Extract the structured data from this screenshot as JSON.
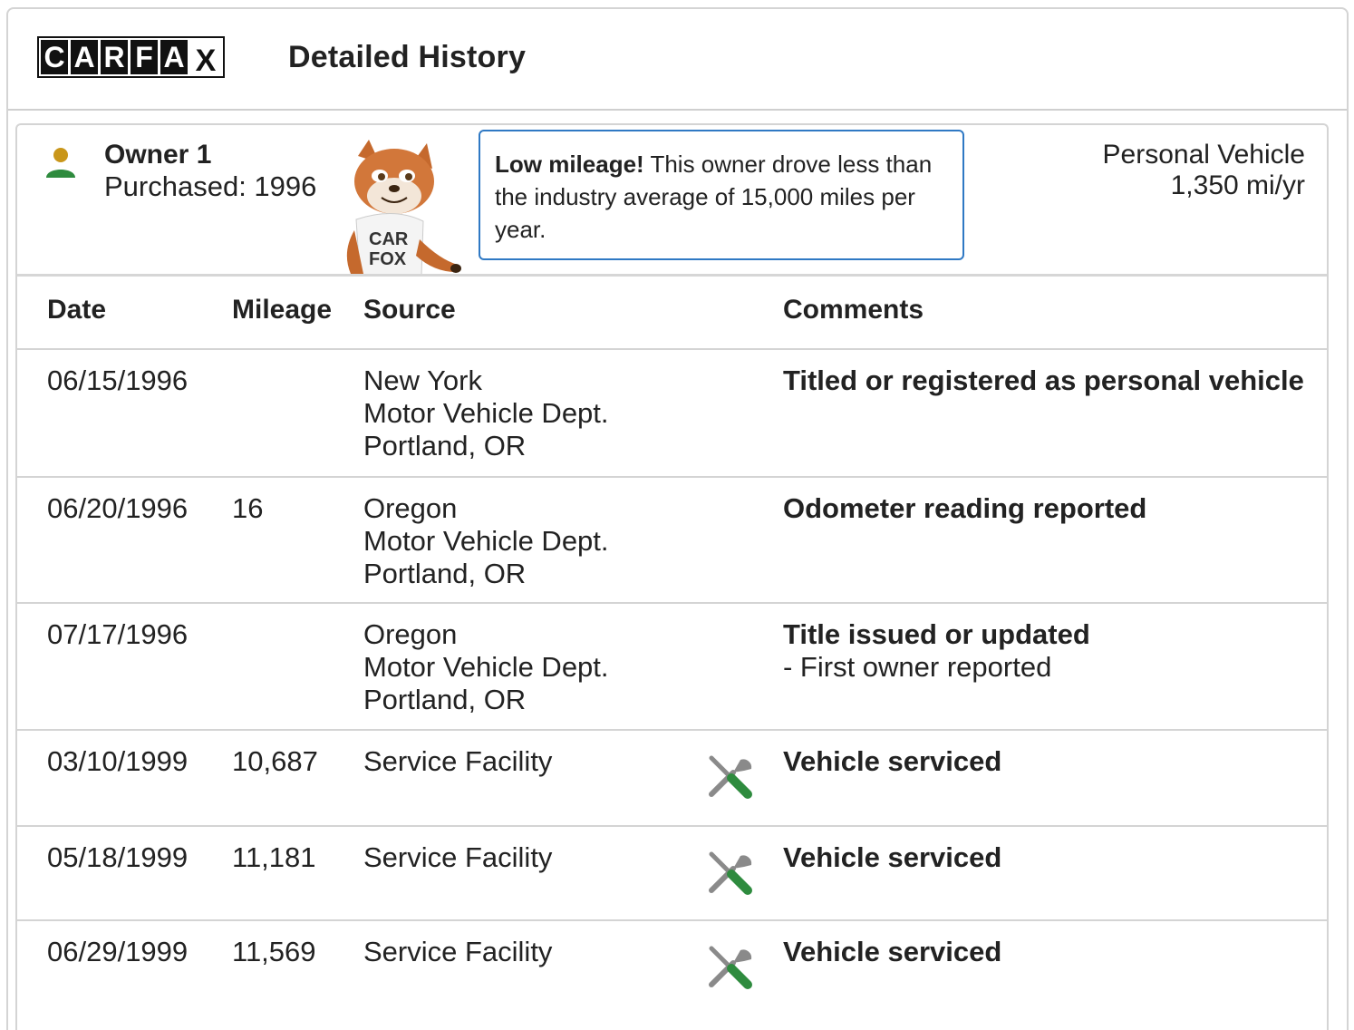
{
  "header": {
    "logo_letters": [
      "C",
      "A",
      "R",
      "F",
      "A",
      "X"
    ],
    "title": "Detailed History"
  },
  "owner": {
    "title": "Owner 1",
    "purchased": "Purchased: 1996",
    "callout_bold": "Low mileage!",
    "callout_text": " This owner drove less than the industry average of 15,000 miles per year.",
    "vehicle_type": "Personal Vehicle",
    "annual_mileage": "1,350 mi/yr",
    "icon_head_color": "#c9961a",
    "icon_body_color": "#2e8b3e",
    "mascot_shirt_text": [
      "CAR",
      "FOX"
    ]
  },
  "table": {
    "headers": {
      "date": "Date",
      "mileage": "Mileage",
      "source": "Source",
      "comments": "Comments"
    },
    "rows": [
      {
        "date": "06/15/1996",
        "mileage": "",
        "source": [
          "New York",
          "Motor Vehicle Dept.",
          "Portland, OR"
        ],
        "comment": "Titled or registered as personal vehicle",
        "comment_detail": "",
        "icon": ""
      },
      {
        "date": "06/20/1996",
        "mileage": "16",
        "source": [
          "Oregon",
          "Motor Vehicle Dept.",
          "Portland, OR"
        ],
        "comment": "Odometer reading reported",
        "comment_detail": "",
        "icon": ""
      },
      {
        "date": "07/17/1996",
        "mileage": "",
        "source": [
          "Oregon",
          "Motor Vehicle Dept.",
          "Portland, OR"
        ],
        "comment": "Title issued or updated",
        "comment_detail": "- First owner reported",
        "icon": ""
      },
      {
        "date": "03/10/1999",
        "mileage": "10,687",
        "source": [
          "Service Facility"
        ],
        "comment": "Vehicle serviced",
        "comment_detail": "",
        "icon": "wrench-screwdriver-icon"
      },
      {
        "date": "05/18/1999",
        "mileage": "11,181",
        "source": [
          "Service Facility"
        ],
        "comment": "Vehicle serviced",
        "comment_detail": "",
        "icon": "wrench-screwdriver-icon"
      },
      {
        "date": "06/29/1999",
        "mileage": "11,569",
        "source": [
          "Service Facility"
        ],
        "comment": "Vehicle serviced",
        "comment_detail": "",
        "icon": "wrench-screwdriver-icon"
      }
    ]
  },
  "colors": {
    "callout_border": "#2f79c4",
    "tool_grey": "#8a8a8a",
    "tool_green": "#2e8b3e"
  }
}
